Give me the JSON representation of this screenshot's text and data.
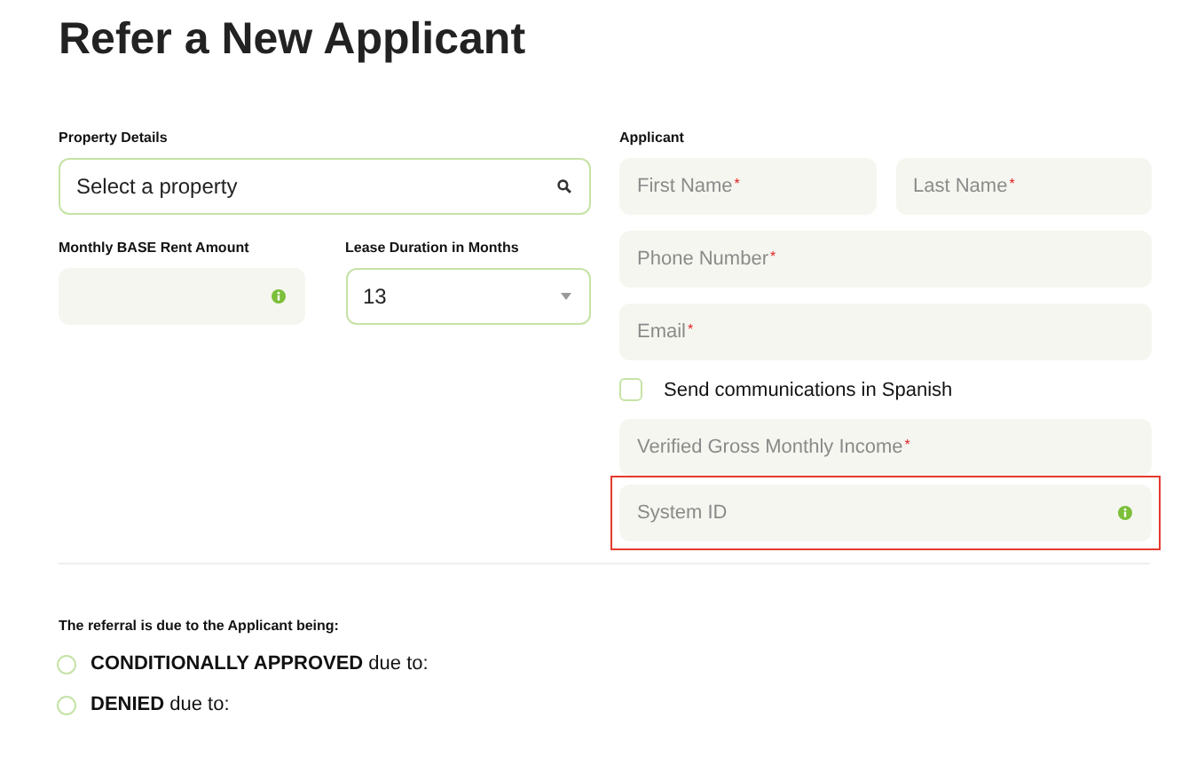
{
  "title": "Refer a New Applicant",
  "property_details": {
    "heading": "Property Details",
    "property_field": {
      "placeholder": "Select a property"
    },
    "rent": {
      "label": "Monthly BASE Rent Amount"
    },
    "lease": {
      "label": "Lease Duration in Months",
      "value": "13"
    }
  },
  "applicant": {
    "heading": "Applicant",
    "name_fields": [
      {
        "placeholder": "First Name$^{*}$"
      },
      {
        "placeholder": "Last Name$^{*}$"
      }
    ],
    "fields": [
      {
        "placeholder": "Phone Number$^{*}$"
      },
      {
        "placeholder": "Email$^{*}$"
      }
    ],
    "spanish": {
      "label": "Send communications in Spanish",
      "checked": false
    },
    "fields_after": [
      {
        "placeholder": "Verified Gross Monthly Income$^{*}$",
        "info": false,
        "highlighted": false
      },
      {
        "placeholder": "System ID",
        "info": true,
        "highlighted": true
      }
    ]
  },
  "referral": {
    "heading": "The referral is due to the Applicant being:",
    "options": [
      {
        "label": "**CONDITIONALLY APPROVED** due to:",
        "selected": false
      },
      {
        "label": "**DENIED** due to:",
        "selected": false
      }
    ]
  }
}
